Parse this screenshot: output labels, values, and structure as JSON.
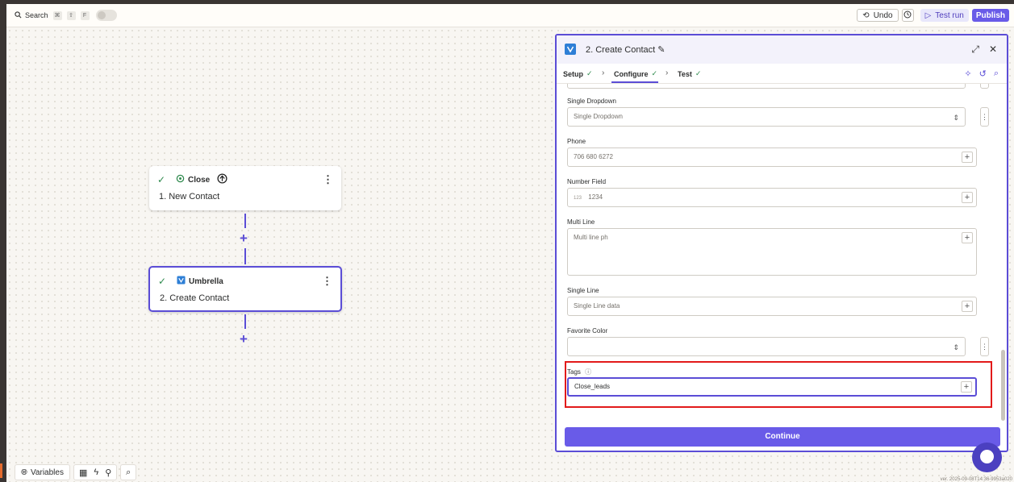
{
  "topbar": {
    "search_label": "Search",
    "shortcut_keys": [
      "⌘",
      "⇧",
      "F"
    ],
    "undo_label": "Undo",
    "test_run_label": "Test run",
    "publish_label": "Publish"
  },
  "canvas": {
    "node1": {
      "app": "Close",
      "title": "1. New Contact"
    },
    "node2": {
      "app": "Umbrella",
      "title": "2. Create Contact"
    }
  },
  "panel": {
    "title": "2. Create Contact",
    "tabs": [
      {
        "label": "Setup"
      },
      {
        "label": "Configure"
      },
      {
        "label": "Test"
      }
    ],
    "fields": {
      "single_dropdown": {
        "label": "Single Dropdown",
        "placeholder": "Single Dropdown"
      },
      "phone": {
        "label": "Phone",
        "placeholder": "706 680 6272"
      },
      "number_field": {
        "label": "Number Field",
        "prefix": "123",
        "placeholder": "1234"
      },
      "multi_line": {
        "label": "Multi Line",
        "placeholder": "Multi line ph"
      },
      "single_line": {
        "label": "Single Line",
        "placeholder": "Single Line data"
      },
      "favorite_color": {
        "label": "Favorite Color",
        "value": ""
      },
      "tags": {
        "label": "Tags",
        "value": "Close_leads"
      }
    },
    "continue_label": "Continue"
  },
  "bottombar": {
    "variables_label": "Variables"
  },
  "version_text": "ver. 2025-09-08T14:36-9953a020"
}
